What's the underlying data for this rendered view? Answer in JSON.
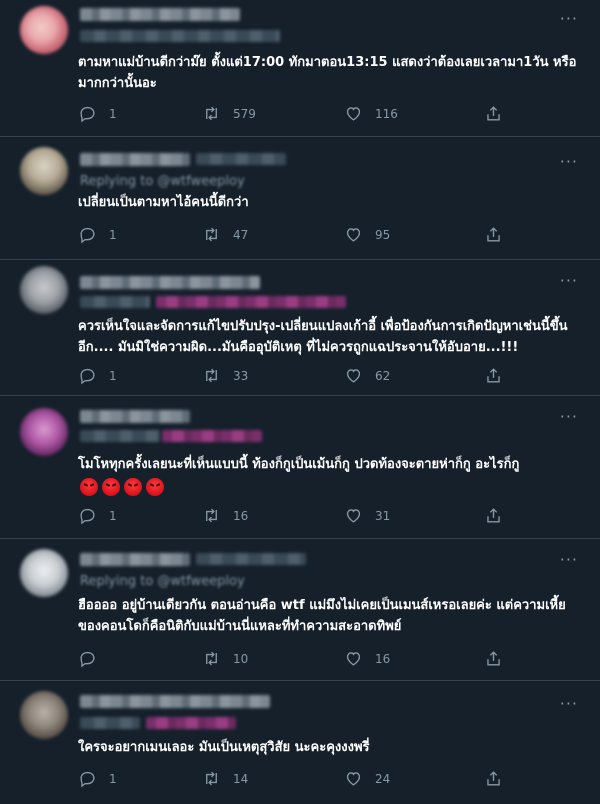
{
  "tweets": [
    {
      "replying_to": "",
      "text": "ตามหาแม่บ้านดีกว่าม๊ย ตั้งแต่17:00 ทักมาตอน13:15 แสดงว่าต้องเลยเวลามา1วัน หรือมากกว่านั้นอะ",
      "replies": "1",
      "retweets": "579",
      "likes": "116",
      "emojis": 0
    },
    {
      "replying_to": "Replying to @wtfweeploy",
      "text": "เปลี่ยนเป็นตามหาไอ้คนนี้ดีกว่า",
      "replies": "1",
      "retweets": "47",
      "likes": "95",
      "emojis": 0
    },
    {
      "replying_to": "",
      "text": "ควรเห็นใจและจัดการแก้ไขปรับปรุง-เปลี่ยนแปลงเก้าอี้ เพื่อป้องกันการเกิดปัญหาเช่นนี้ขึ้นอีก.... มันมิใช่ความผิด...มันคืออุบัติเหตุ ที่ไม่ควรถูกแฉประจานให้อับอาย...!!!",
      "replies": "1",
      "retweets": "33",
      "likes": "62",
      "emojis": 0
    },
    {
      "replying_to": "",
      "text": "โมโหทุกครั้งเลยนะที่เห็นแบบนี้ ท้องก็กูเป็นเม้นก็กู ปวดท้องจะตายห่าก็กู อะไรก็กู",
      "replies": "1",
      "retweets": "16",
      "likes": "31",
      "emojis": 4
    },
    {
      "replying_to": "Replying to @wtfweeploy",
      "text": "ฮืออออ อยู่บ้านเดียวกัน ตอนอ่านคือ wtf แม่มึงไม่เคยเป็นเมนส์เหรอเลยค่ะ แต่ความเหี้ยของคอนโดก็คือนิติกับแม่บ้านนี่แหละที่ทำความสะอาดทิพย์",
      "replies": "",
      "retweets": "10",
      "likes": "16",
      "emojis": 0
    },
    {
      "replying_to": "",
      "text": "ใครจะอยากเมนเลอะ มันเป็นเหตุสุวิสัย นะคะคุงงงพรี่",
      "replies": "1",
      "retweets": "14",
      "likes": "24",
      "emojis": 0
    }
  ],
  "colors": {
    "background": "#15202b",
    "divider": "#38444d",
    "secondary_text": "#8899a6",
    "mention": "#b04a97"
  },
  "icons": {
    "reply": "reply-icon",
    "retweet": "retweet-icon",
    "like": "heart-icon",
    "share": "share-icon",
    "more": "more-icon"
  }
}
